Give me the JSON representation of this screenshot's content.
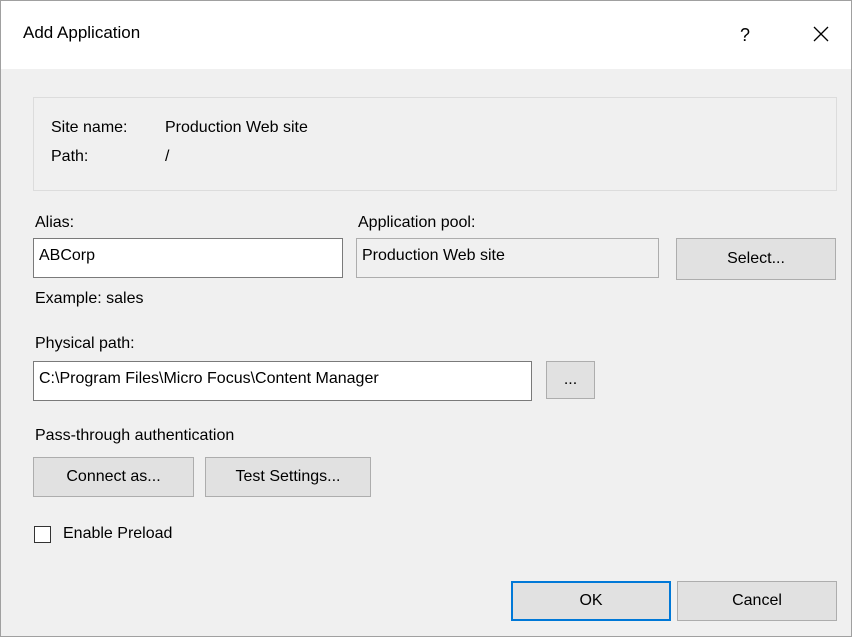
{
  "window": {
    "title": "Add Application",
    "help_label": "?"
  },
  "site": {
    "name_label": "Site name:",
    "name_value": "Production Web site",
    "path_label": "Path:",
    "path_value": "/"
  },
  "alias": {
    "label": "Alias:",
    "value": "ABCorp",
    "example": "Example: sales"
  },
  "app_pool": {
    "label": "Application pool:",
    "value": "Production Web site",
    "select_label": "Select..."
  },
  "physical_path": {
    "label": "Physical path:",
    "value": "C:\\Program Files\\Micro Focus\\Content Manager",
    "browse_label": "..."
  },
  "auth": {
    "label": "Pass-through authentication",
    "connect_label": "Connect as...",
    "test_label": "Test Settings..."
  },
  "preload": {
    "label": "Enable Preload",
    "checked": false
  },
  "footer": {
    "ok_label": "OK",
    "cancel_label": "Cancel"
  },
  "colors": {
    "accent": "#0078d7",
    "dialog_bg": "#f0f0f0",
    "button_bg": "#e1e1e1"
  }
}
